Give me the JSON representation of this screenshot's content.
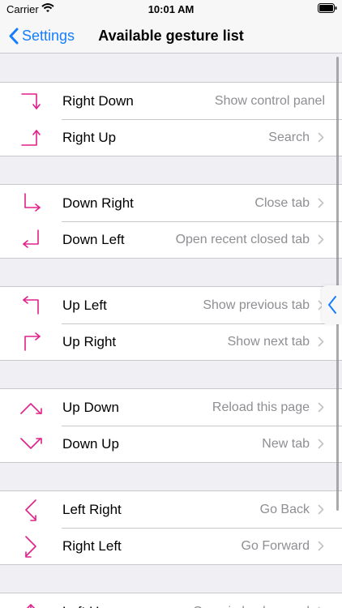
{
  "status_bar": {
    "carrier": "Carrier",
    "time": "10:01 AM"
  },
  "nav": {
    "back_label": "Settings",
    "title": "Available gesture list"
  },
  "colors": {
    "accent": "#157efb",
    "gesture": "#e0208a",
    "secondary_text": "#8e8e93"
  },
  "groups": [
    {
      "rows": [
        {
          "icon": "right-down-gesture-icon",
          "name": "Right Down",
          "action": "Show control panel",
          "chevron": false
        },
        {
          "icon": "right-up-gesture-icon",
          "name": "Right Up",
          "action": "Search",
          "chevron": true
        }
      ]
    },
    {
      "rows": [
        {
          "icon": "down-right-gesture-icon",
          "name": "Down Right",
          "action": "Close tab",
          "chevron": true
        },
        {
          "icon": "down-left-gesture-icon",
          "name": "Down Left",
          "action": "Open recent closed tab",
          "chevron": true
        }
      ]
    },
    {
      "rows": [
        {
          "icon": "up-left-gesture-icon",
          "name": "Up Left",
          "action": "Show previous tab",
          "chevron": true
        },
        {
          "icon": "up-right-gesture-icon",
          "name": "Up Right",
          "action": "Show next tab",
          "chevron": true
        }
      ]
    },
    {
      "rows": [
        {
          "icon": "up-down-gesture-icon",
          "name": "Up Down",
          "action": "Reload this page",
          "chevron": true
        },
        {
          "icon": "down-up-gesture-icon",
          "name": "Down Up",
          "action": "New tab",
          "chevron": true
        }
      ]
    },
    {
      "rows": [
        {
          "icon": "left-right-gesture-icon",
          "name": "Left Right",
          "action": "Go Back",
          "chevron": true
        },
        {
          "icon": "right-left-gesture-icon",
          "name": "Right Left",
          "action": "Go Forward",
          "chevron": true
        }
      ]
    },
    {
      "rows": [
        {
          "icon": "left-up-gesture-icon",
          "name": "Left Up",
          "action": "Open in background",
          "chevron": true
        }
      ]
    }
  ]
}
